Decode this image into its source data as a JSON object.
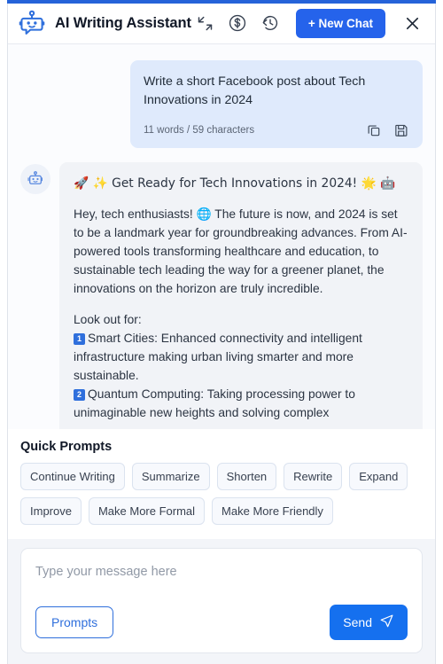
{
  "header": {
    "title": "AI Writing Assistant",
    "icons": [
      {
        "name": "expand-collapse-icon",
        "label": "expand"
      },
      {
        "name": "credits-icon",
        "label": "credits"
      },
      {
        "name": "history-icon",
        "label": "history"
      }
    ],
    "new_chat_label": "+ New Chat",
    "close_label": "×",
    "accent_color": "#2563eb"
  },
  "chat": {
    "user_message": {
      "text": "Write a short Facebook post about Tech Innovations in 2024",
      "meta": "11 words / 59 characters",
      "copy_icon": "copy-icon",
      "save_icon": "save-icon",
      "bubble_color": "#dfeafc"
    },
    "assistant_message": {
      "avatar_icon": "robot-avatar-icon",
      "heading": "🚀 ✨ Get Ready for Tech Innovations in 2024! 🌟 🤖",
      "paragraph_1": "Hey, tech enthusiasts! 🌐 The future is now, and 2024 is set to be a landmark year for groundbreaking advances. From AI-powered tools transforming healthcare and education, to sustainable tech leading the way for a greener planet, the innovations on the horizon are truly incredible.",
      "list_intro": "Look out for:",
      "item_1_num": "1",
      "item_1": "Smart Cities: Enhanced connectivity and intelligent infrastructure making urban living smarter and more sustainable.",
      "item_2_num": "2",
      "item_2": "Quantum Computing: Taking processing power to unimaginable new heights and solving complex",
      "bubble_color": "#f1f3f7"
    }
  },
  "quick_prompts": {
    "title": "Quick Prompts",
    "chips": [
      "Continue Writing",
      "Summarize",
      "Shorten",
      "Rewrite",
      "Expand",
      "Improve",
      "Make More Formal",
      "Make More Friendly"
    ]
  },
  "composer": {
    "placeholder": "Type your message here",
    "value": "",
    "prompts_label": "Prompts",
    "send_label": "Send",
    "send_icon": "paper-plane-icon"
  }
}
